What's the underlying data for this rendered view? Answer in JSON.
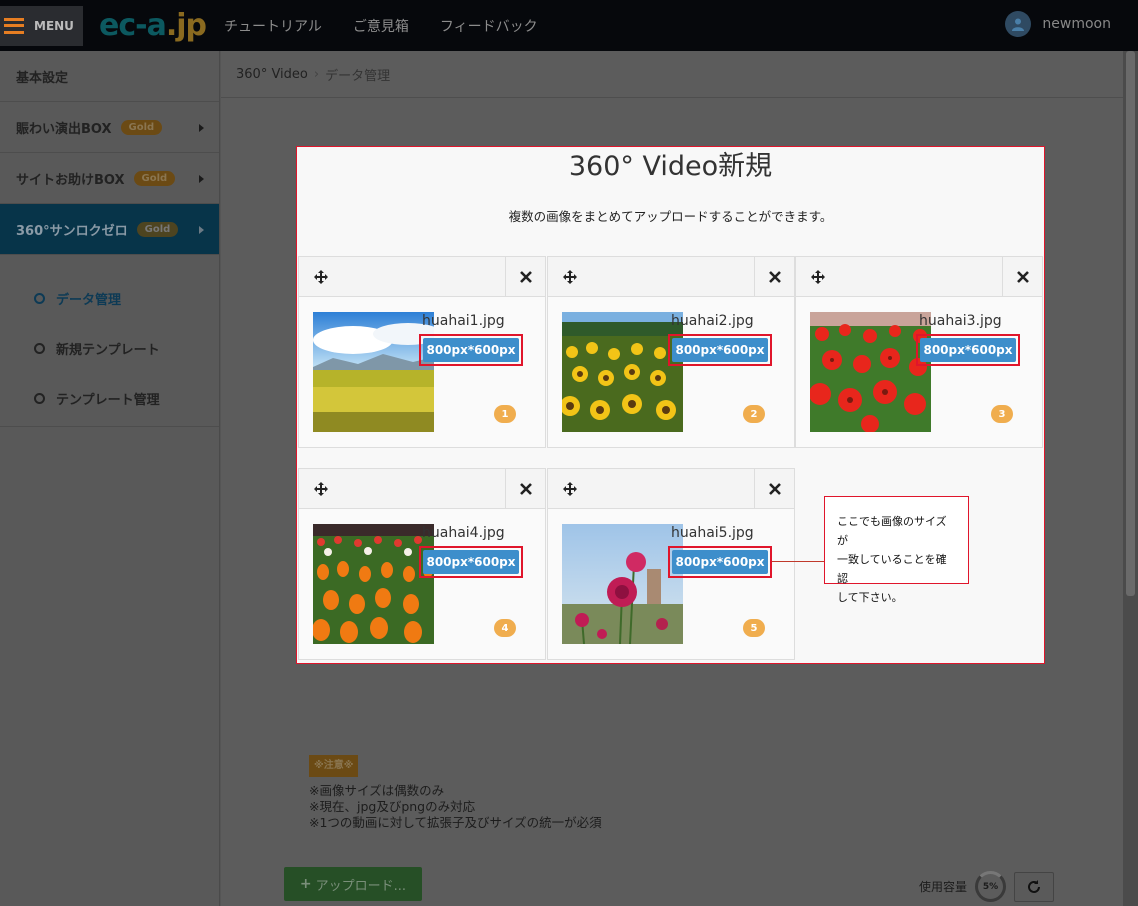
{
  "topbar": {
    "menu_label": "MENU",
    "logo_prefix": "ec-a",
    "logo_suffix": ".jp",
    "nav": [
      "チュートリアル",
      "ご意見箱",
      "フィードバック"
    ],
    "username": "newmoon"
  },
  "sidebar": {
    "items": [
      {
        "label": "基本設定"
      },
      {
        "label": "賑わい演出BOX",
        "badge": "Gold"
      },
      {
        "label": "サイトお助けBOX",
        "badge": "Gold"
      },
      {
        "label": "360°サンロクゼロ",
        "badge": "Gold"
      }
    ],
    "sub_items": [
      "データ管理",
      "新規テンプレート",
      "テンプレート管理"
    ]
  },
  "breadcrumb": {
    "root": "360° Video",
    "sep": "›",
    "current": "データ管理"
  },
  "modal": {
    "title": "360° Video新規",
    "description": "複数の画像をまとめてアップロードすることができます。",
    "cards": [
      {
        "filename": "huahai1.jpg",
        "size": "800px*600px",
        "index": "1"
      },
      {
        "filename": "huahai2.jpg",
        "size": "800px*600px",
        "index": "2"
      },
      {
        "filename": "huahai3.jpg",
        "size": "800px*600px",
        "index": "3"
      },
      {
        "filename": "huahai4.jpg",
        "size": "800px*600px",
        "index": "4"
      },
      {
        "filename": "huahai5.jpg",
        "size": "800px*600px",
        "index": "5"
      }
    ],
    "callout": [
      "ここでも画像のサイズが",
      "一致していることを確認",
      "して下さい。"
    ]
  },
  "notes": {
    "badge": "※注意※",
    "lines": [
      "※画像サイズは偶数のみ",
      "※現在、jpg及びpngのみ対応",
      "※1つの動画に対して拡張子及びサイズの統一が必須"
    ]
  },
  "upload_label": "アップロード...",
  "usage": {
    "label": "使用容量",
    "percent": "5%"
  },
  "colors": {
    "accent": "#3d8ecb",
    "highlight": "#e0152b",
    "badge": "#f0ad4e"
  }
}
